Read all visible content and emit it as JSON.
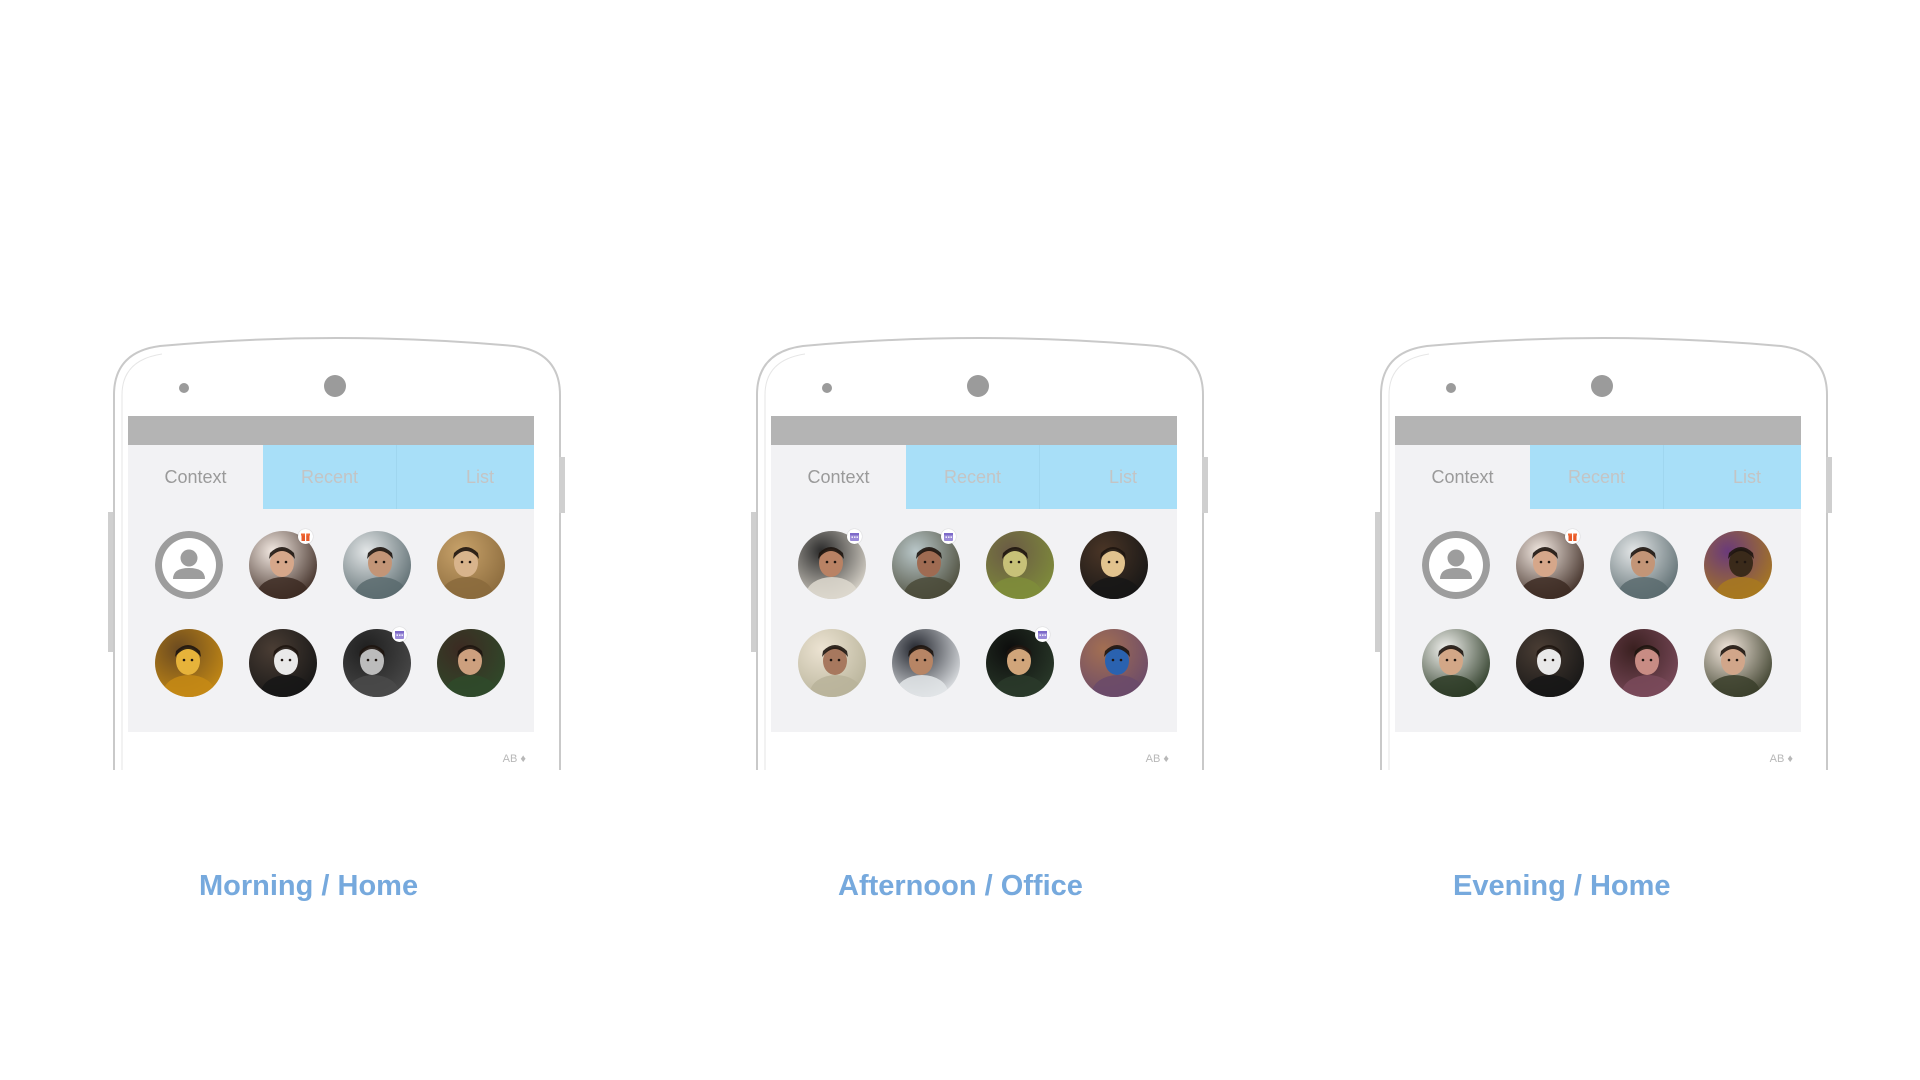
{
  "colors": {
    "accent_tab": "#a8dff8",
    "caption": "#76a9dd",
    "status_bar": "#b4b4b4",
    "screen_bg": "#f2f2f4"
  },
  "panels": [
    {
      "caption": "Morning / Home",
      "tabs": {
        "context": "Context",
        "recent": "Recent",
        "list": "List"
      },
      "keyboard_label": "AB ♦",
      "contacts": [
        {
          "kind": "placeholder",
          "icon": "person-icon",
          "badge": ""
        },
        {
          "kind": "photo",
          "palette": [
            "#3c2a22",
            "#d6a78a",
            "#f3e9e2"
          ],
          "badge": "gift-icon"
        },
        {
          "kind": "photo",
          "palette": [
            "#5b6b6f",
            "#c39577",
            "#e3e6e7"
          ],
          "badge": ""
        },
        {
          "kind": "photo",
          "palette": [
            "#8a6a3c",
            "#d8b48c",
            "#c8a26a"
          ],
          "badge": ""
        },
        {
          "kind": "photo",
          "palette": [
            "#c58a15",
            "#e7b33a",
            "#6b4a20"
          ],
          "badge": ""
        },
        {
          "kind": "photo",
          "palette": [
            "#161616",
            "#e9e9e9",
            "#4a3d34"
          ],
          "badge": ""
        },
        {
          "kind": "photo",
          "palette": [
            "#4a4a4a",
            "#bcbcbc",
            "#1f1f1f"
          ],
          "badge": "calendar-icon"
        },
        {
          "kind": "photo",
          "palette": [
            "#2f4a2a",
            "#cda07e",
            "#3c2a22"
          ],
          "badge": ""
        }
      ]
    },
    {
      "caption": "Afternoon / Office",
      "tabs": {
        "context": "Context",
        "recent": "Recent",
        "list": "List"
      },
      "keyboard_label": "AB ♦",
      "contacts": [
        {
          "kind": "photo",
          "palette": [
            "#ded9cf",
            "#b98264",
            "#2a2a2a"
          ],
          "badge": "calendar-icon"
        },
        {
          "kind": "photo",
          "palette": [
            "#4a4a38",
            "#9f6b52",
            "#b9c7c9"
          ],
          "badge": "calendar-icon"
        },
        {
          "kind": "photo",
          "palette": [
            "#7f8d3a",
            "#c7c178",
            "#6a5a45"
          ],
          "badge": ""
        },
        {
          "kind": "photo",
          "palette": [
            "#161616",
            "#e2c38e",
            "#4a3526"
          ],
          "badge": ""
        },
        {
          "kind": "photo",
          "palette": [
            "#b8b39a",
            "#a7785e",
            "#ece3d2"
          ],
          "badge": ""
        },
        {
          "kind": "photo",
          "palette": [
            "#e3e6e9",
            "#b78565",
            "#23262e"
          ],
          "badge": ""
        },
        {
          "kind": "photo",
          "palette": [
            "#2a3a2a",
            "#d1a57a",
            "#0d0d0d"
          ],
          "badge": "calendar-icon"
        },
        {
          "kind": "photo",
          "palette": [
            "#6a4a6a",
            "#2a62b0",
            "#a36f52"
          ],
          "badge": ""
        }
      ]
    },
    {
      "caption": "Evening / Home",
      "tabs": {
        "context": "Context",
        "recent": "Recent",
        "list": "List"
      },
      "keyboard_label": "AB ♦",
      "contacts": [
        {
          "kind": "placeholder",
          "icon": "person-icon",
          "badge": ""
        },
        {
          "kind": "photo",
          "palette": [
            "#3c2a22",
            "#d6a78a",
            "#f3e9e2"
          ],
          "badge": "gift-icon"
        },
        {
          "kind": "photo",
          "palette": [
            "#5b6b6f",
            "#c39577",
            "#e3e6e7"
          ],
          "badge": ""
        },
        {
          "kind": "photo",
          "palette": [
            "#a8791e",
            "#3a2a1a",
            "#6a3a7a"
          ],
          "badge": ""
        },
        {
          "kind": "photo",
          "palette": [
            "#2b3a25",
            "#d3a787",
            "#f2f2ef"
          ],
          "badge": ""
        },
        {
          "kind": "photo",
          "palette": [
            "#161616",
            "#e9e9e9",
            "#4a3d34"
          ],
          "badge": ""
        },
        {
          "kind": "photo",
          "palette": [
            "#7a4a5a",
            "#c88c84",
            "#3a2020"
          ],
          "badge": ""
        },
        {
          "kind": "photo",
          "palette": [
            "#3a3e2a",
            "#d1a68a",
            "#f2e6dc"
          ],
          "badge": ""
        }
      ]
    }
  ]
}
